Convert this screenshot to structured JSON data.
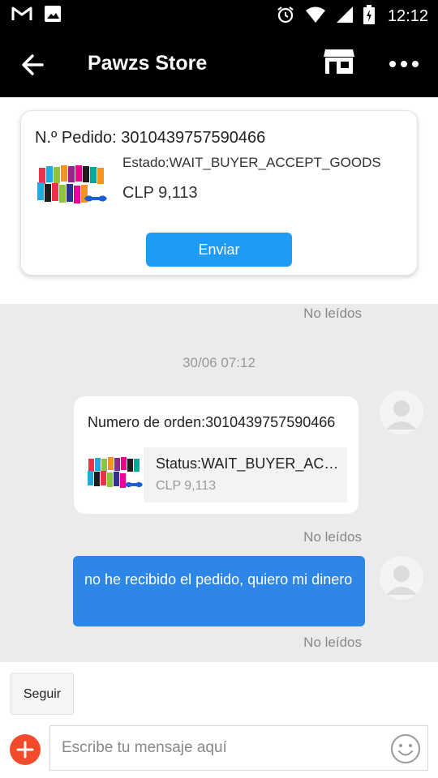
{
  "status_bar": {
    "time": "12:12",
    "left_icons": [
      "gmail-icon",
      "image-icon"
    ],
    "right_icons": [
      "alarm-icon",
      "wifi-icon",
      "signal-icon",
      "battery-icon"
    ]
  },
  "app_bar": {
    "title": "Pawzs Store",
    "icons": [
      "back-arrow-icon",
      "store-icon",
      "more-icon"
    ]
  },
  "order_card": {
    "order_number": "N.º Pedido: 3010439757590466",
    "status": "Estado:WAIT_BUYER_ACCEPT_GOODS",
    "price": "CLP 9,113",
    "send_button": "Enviar"
  },
  "chat": {
    "unread_label_1": "No leídos",
    "timestamp": "30/06 07:12",
    "order_message": {
      "title": "Numero de orden:3010439757590466",
      "status": "Status:WAIT_BUYER_ACCEPT_GOODS",
      "price": "CLP 9,113"
    },
    "unread_label_2": "No leídos",
    "text_message": "no he recibido el pedido, quiero mi dinero",
    "unread_label_3": "No leídos"
  },
  "bottom": {
    "follow_button": "Seguir",
    "input_placeholder": "Escribe tu mensaje aquí",
    "icons": [
      "plus-icon",
      "emoji-icon"
    ]
  },
  "colors": {
    "accent_blue": "#1e9bf5",
    "bubble_blue": "#2e87e8",
    "plus_red": "#f24a2b"
  }
}
